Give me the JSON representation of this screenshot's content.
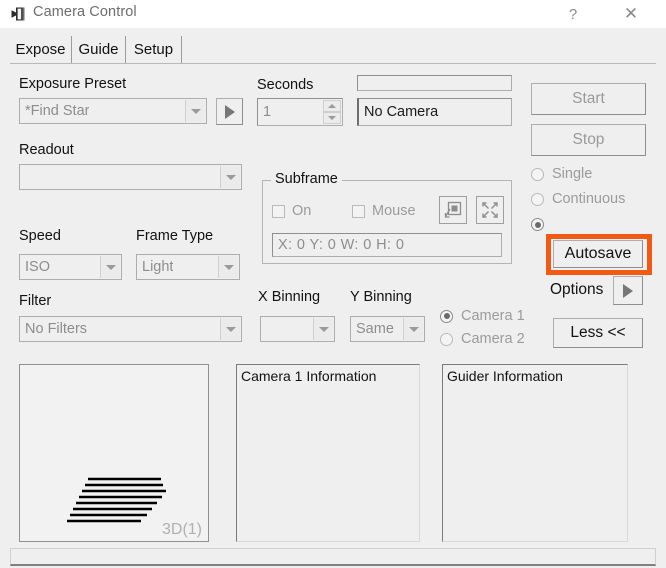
{
  "window": {
    "title": "Camera Control",
    "icon": "camera-icon",
    "help_label": "?",
    "close_label": "✕"
  },
  "tabs": [
    {
      "label": "Expose",
      "selected": true
    },
    {
      "label": "Guide",
      "selected": false
    },
    {
      "label": "Setup",
      "selected": false
    }
  ],
  "left_panel": {
    "exposure_preset_label": "Exposure Preset",
    "exposure_preset_value": "*Find Star",
    "preset_go_icon": "play-arrow-icon",
    "readout_label": "Readout",
    "readout_value": "",
    "speed_label": "Speed",
    "speed_value": "ISO",
    "frame_type_label": "Frame Type",
    "frame_type_value": "Light",
    "filter_label": "Filter",
    "filter_value": "No Filters"
  },
  "middle_panel": {
    "seconds_label": "Seconds",
    "seconds_value": "1",
    "status_bar_value": "",
    "camera_status_value": "No Camera",
    "subframe_label": "Subframe",
    "subframe_on_label": "On",
    "subframe_mouse_label": "Mouse",
    "subframe_select_icon": "subframe-select-icon",
    "subframe_fullframe_icon": "expand-arrows-icon",
    "subframe_coords": "X:  0 Y:  0 W:  0 H:  0",
    "x_binning_label": "X Binning",
    "x_binning_value": "",
    "y_binning_label": "Y Binning",
    "y_binning_value": "Same"
  },
  "right_panel": {
    "start_label": "Start",
    "stop_label": "Stop",
    "modes": [
      {
        "label": "Single",
        "checked": false
      },
      {
        "label": "Continuous",
        "checked": false
      },
      {
        "label": "Autosave",
        "checked": true
      }
    ],
    "options_label": "Options",
    "options_arrow_icon": "play-arrow-icon",
    "less_label": "Less <<",
    "cameras": [
      {
        "label": "Camera 1",
        "checked": true
      },
      {
        "label": "Camera 2",
        "checked": false
      }
    ]
  },
  "bottom": {
    "preview_tag": "3D(1)",
    "preview_graphic": "striped-parallelogram",
    "camera_info_title": "Camera 1 Information",
    "guider_info_title": "Guider Information"
  },
  "annotation": {
    "highlight_target": "Autosave",
    "highlight_color": "#f15a14"
  }
}
